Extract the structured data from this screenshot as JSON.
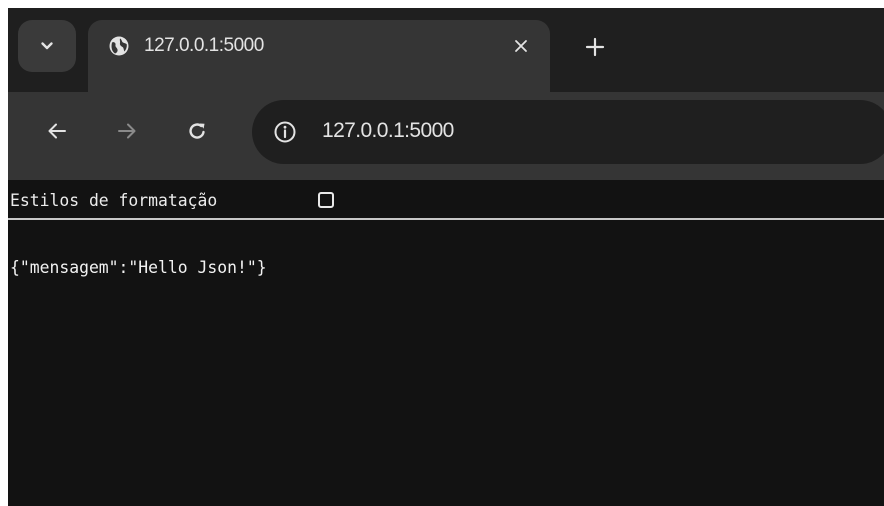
{
  "tabstrip": {
    "active_tab": {
      "title": "127.0.0.1:5000"
    }
  },
  "omnibox": {
    "url": "127.0.0.1:5000"
  },
  "pretty_print": {
    "label": "Estilos de formatação",
    "checked": false
  },
  "page": {
    "json_text": "{\"mensagem\":\"Hello Json!\"}"
  },
  "icons": {
    "tab_search": "chevron-down-icon",
    "favicon": "globe-icon",
    "tab_close": "close-icon",
    "new_tab": "plus-icon",
    "back": "arrow-left-icon",
    "forward": "arrow-right-icon",
    "reload": "reload-icon",
    "site_info": "info-icon"
  },
  "colors": {
    "tabstrip_bg": "#1f1f1f",
    "active_tab_bg": "#353535",
    "omnibox_bg": "#1f1f1f",
    "page_bg": "#121212",
    "text": "#e3e3e3"
  }
}
